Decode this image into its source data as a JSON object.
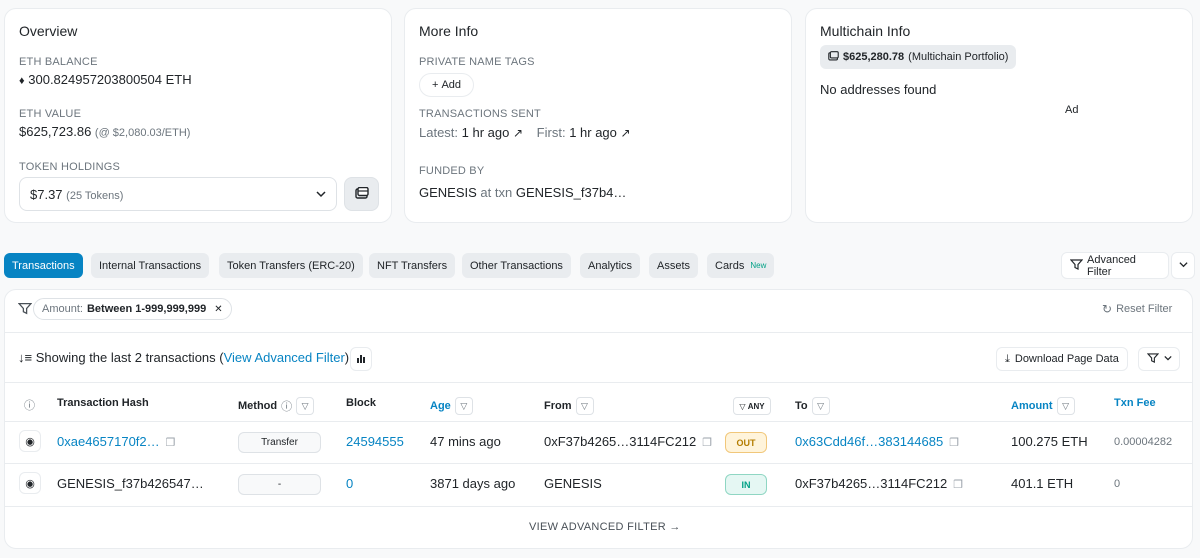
{
  "overview": {
    "title": "Overview",
    "eth_balance_label": "ETH BALANCE",
    "eth_balance_value": "300.824957203800504 ETH",
    "eth_value_label": "ETH VALUE",
    "eth_value_amount": "$625,723.86",
    "eth_value_rate": "(@ $2,080.03/ETH)",
    "token_holdings_label": "TOKEN HOLDINGS",
    "token_holdings_value": "$7.37",
    "token_holdings_count": "(25 Tokens)"
  },
  "more_info": {
    "title": "More Info",
    "private_tags_label": "PRIVATE NAME TAGS",
    "add_label": "Add",
    "tx_sent_label": "TRANSACTIONS SENT",
    "latest_label": "Latest:",
    "latest_value": "1 hr ago",
    "first_label": "First:",
    "first_value": "1 hr ago",
    "funded_by_label": "FUNDED BY",
    "funded_by_source": "GENESIS",
    "funded_by_at": "at txn",
    "funded_by_txn": "GENESIS_f37b4…"
  },
  "multichain": {
    "title": "Multichain Info",
    "portfolio_value": "$625,280.78",
    "portfolio_label": "(Multichain Portfolio)",
    "no_addresses": "No addresses found",
    "ad_label": "Ad"
  },
  "tabs": [
    {
      "label": "Transactions"
    },
    {
      "label": "Internal Transactions"
    },
    {
      "label": "Token Transfers (ERC-20)"
    },
    {
      "label": "NFT Transfers"
    },
    {
      "label": "Other Transactions"
    },
    {
      "label": "Analytics"
    },
    {
      "label": "Assets"
    },
    {
      "label": "Cards",
      "badge": "New"
    }
  ],
  "advanced_filter_label": "Advanced Filter",
  "filter": {
    "chip_key": "Amount:",
    "chip_value": "Between 1-999,999,999",
    "reset_label": "Reset Filter"
  },
  "summary": {
    "prefix": "Showing the last 2 transactions (",
    "link": "View Advanced Filter",
    "suffix": ")",
    "download_label": "Download Page Data"
  },
  "table": {
    "headers": {
      "hash": "Transaction Hash",
      "method": "Method",
      "block": "Block",
      "age": "Age",
      "from": "From",
      "any": "ANY",
      "to": "To",
      "amount": "Amount",
      "fee": "Txn Fee"
    },
    "rows": [
      {
        "hash": "0xae4657170f2…",
        "method": "Transfer",
        "block": "24594555",
        "age": "47 mins ago",
        "from": "0xF37b4265…3114FC212",
        "direction": "OUT",
        "to": "0x63Cdd46f…383144685",
        "amount": "100.275 ETH",
        "fee": "0.00004282"
      },
      {
        "hash": "GENESIS_f37b426547…",
        "method": "-",
        "block": "0",
        "age": "3871 days ago",
        "from": "GENESIS",
        "direction": "IN",
        "to": "0xF37b4265…3114FC212",
        "amount": "401.1 ETH",
        "fee": "0"
      }
    ],
    "footer_link": "VIEW ADVANCED FILTER"
  },
  "colors": {
    "accent": "#0784c3",
    "out_badge": "#b47d00",
    "in_badge": "#00a186"
  }
}
